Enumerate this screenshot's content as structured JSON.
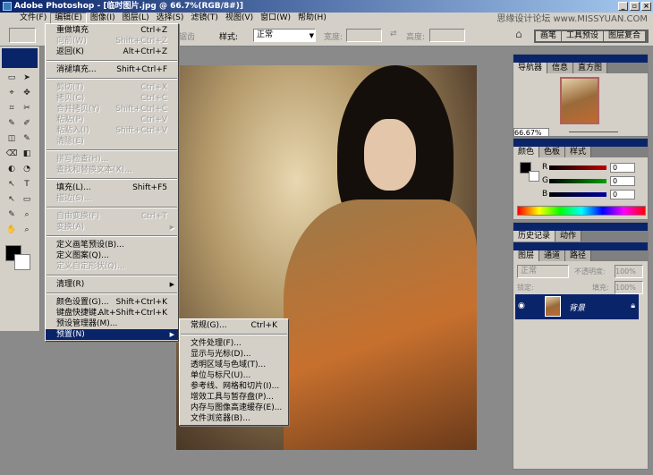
{
  "window": {
    "title": "Adobe Photoshop - [临时图片.jpg @ 66.7%(RGB/8#)]",
    "watermark": "思缘设计论坛 www.MISSYUAN.COM"
  },
  "menubar": [
    "文件(F)",
    "编辑(E)",
    "图像(I)",
    "图层(L)",
    "选择(S)",
    "滤镜(T)",
    "视图(V)",
    "窗口(W)",
    "帮助(H)"
  ],
  "options": {
    "antialias": "锯齿",
    "style_label": "样式:",
    "style_value": "正常",
    "width_label": "宽度:",
    "height_label": "高度:",
    "tabs": [
      "画笔",
      "工具预设",
      "图层复合"
    ]
  },
  "edit_menu": [
    {
      "label": "重做填充",
      "shortcut": "Ctrl+Z",
      "enabled": true
    },
    {
      "label": "向前(W)",
      "shortcut": "Shift+Ctrl+Z",
      "enabled": false
    },
    {
      "label": "返回(K)",
      "shortcut": "Alt+Ctrl+Z",
      "enabled": true
    },
    {
      "sep": true
    },
    {
      "label": "消褪填充...",
      "shortcut": "Shift+Ctrl+F",
      "enabled": true
    },
    {
      "sep": true
    },
    {
      "label": "剪切(T)",
      "shortcut": "Ctrl+X",
      "enabled": false
    },
    {
      "label": "拷贝(C)",
      "shortcut": "Ctrl+C",
      "enabled": false
    },
    {
      "label": "合并拷贝(Y)",
      "shortcut": "Shift+Ctrl+C",
      "enabled": false
    },
    {
      "label": "粘贴(P)",
      "shortcut": "Ctrl+V",
      "enabled": false
    },
    {
      "label": "粘贴入(I)",
      "shortcut": "Shift+Ctrl+V",
      "enabled": false
    },
    {
      "label": "清除(E)",
      "shortcut": "",
      "enabled": false
    },
    {
      "sep": true
    },
    {
      "label": "拼写检查(H)...",
      "shortcut": "",
      "enabled": false
    },
    {
      "label": "查找和替换文本(X)...",
      "shortcut": "",
      "enabled": false
    },
    {
      "sep": true
    },
    {
      "label": "填充(L)...",
      "shortcut": "Shift+F5",
      "enabled": true
    },
    {
      "label": "描边(S)...",
      "shortcut": "",
      "enabled": false
    },
    {
      "sep": true
    },
    {
      "label": "自由变换(F)",
      "shortcut": "Ctrl+T",
      "enabled": false
    },
    {
      "label": "变换(A)",
      "shortcut": "",
      "enabled": false,
      "submenu": true
    },
    {
      "sep": true
    },
    {
      "label": "定义画笔预设(B)...",
      "shortcut": "",
      "enabled": true
    },
    {
      "label": "定义图案(Q)...",
      "shortcut": "",
      "enabled": true
    },
    {
      "label": "定义自定形状(Q)...",
      "shortcut": "",
      "enabled": false
    },
    {
      "sep": true
    },
    {
      "label": "清理(R)",
      "shortcut": "",
      "enabled": true,
      "submenu": true
    },
    {
      "sep": true
    },
    {
      "label": "颜色设置(G)...",
      "shortcut": "Shift+Ctrl+K",
      "enabled": true
    },
    {
      "label": "键盘快捷键...",
      "shortcut": "Alt+Shift+Ctrl+K",
      "enabled": true
    },
    {
      "label": "预设管理器(M)...",
      "shortcut": "",
      "enabled": true
    },
    {
      "label": "预置(N)",
      "shortcut": "",
      "enabled": true,
      "submenu": true,
      "selected": true
    }
  ],
  "prefs_submenu": [
    {
      "label": "常规(G)...",
      "shortcut": "Ctrl+K"
    },
    {
      "sep": true
    },
    {
      "label": "文件处理(F)..."
    },
    {
      "label": "显示与光标(D)..."
    },
    {
      "label": "透明区域与色域(T)..."
    },
    {
      "label": "单位与标尺(U)..."
    },
    {
      "label": "参考线、网格和切片(I)..."
    },
    {
      "label": "增效工具与暂存盘(P)..."
    },
    {
      "label": "内存与图像高速缓存(E)..."
    },
    {
      "label": "文件浏览器(B)..."
    }
  ],
  "navigator": {
    "tabs": [
      "导航器",
      "信息",
      "直方图"
    ],
    "zoom": "66.67%"
  },
  "color": {
    "tabs": [
      "颜色",
      "色板",
      "样式"
    ],
    "channels": [
      {
        "name": "R",
        "value": "0",
        "color": "#c00000"
      },
      {
        "name": "G",
        "value": "0",
        "color": "#00a000"
      },
      {
        "name": "B",
        "value": "0",
        "color": "#0000a0"
      }
    ]
  },
  "history": {
    "tabs": [
      "历史记录",
      "动作"
    ]
  },
  "layers": {
    "tabs": [
      "图层",
      "通道",
      "路径"
    ],
    "blend": "正常",
    "opacity_label": "不透明度:",
    "opacity": "100%",
    "lock_label": "锁定:",
    "fill_label": "填充:",
    "fill": "100%",
    "layer_name": "背景"
  },
  "colors": {
    "title": "#0a246a",
    "chrome": "#d4d0c8"
  }
}
